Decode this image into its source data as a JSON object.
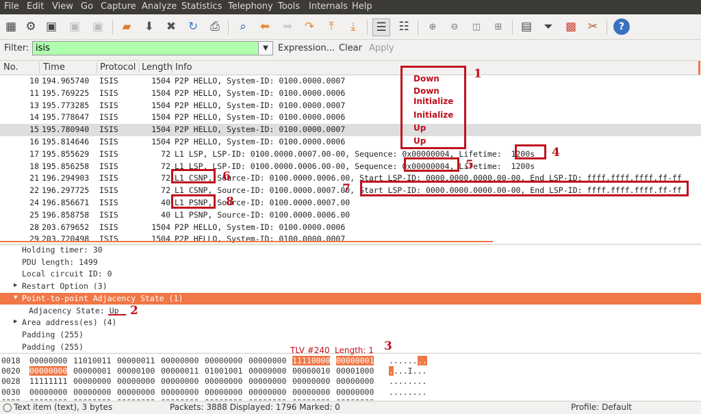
{
  "menu": [
    "File",
    "Edit",
    "View",
    "Go",
    "Capture",
    "Analyze",
    "Statistics",
    "Telephony",
    "Tools",
    "Internals",
    "Help"
  ],
  "toolbar": {
    "icons": [
      "interface-list-icon",
      "capture-options-icon",
      "start-capture-icon",
      "stop-capture-icon",
      "restart-capture-icon",
      "open-file-icon",
      "save-file-icon",
      "close-file-icon",
      "reload-icon",
      "print-icon",
      "find-packet-icon",
      "go-back-icon",
      "go-forward-icon",
      "go-to-packet-icon",
      "go-first-icon",
      "go-last-icon",
      "colorize-icon",
      "auto-scroll-icon",
      "zoom-in-icon",
      "zoom-out-icon",
      "normal-size-icon",
      "resize-columns-icon",
      "capture-filters-icon",
      "display-filters-icon",
      "coloring-rules-icon",
      "preferences-icon",
      "help-icon"
    ]
  },
  "filter": {
    "label": "Filter:",
    "value": "isis",
    "expression": "Expression...",
    "clear": "Clear",
    "apply": "Apply"
  },
  "packet_list": {
    "columns": [
      "No.",
      "Time",
      "Protocol",
      "Length",
      "Info"
    ],
    "rows": [
      {
        "no": "10",
        "time": "194.965740",
        "proto": "ISIS",
        "len": "1504",
        "info": "P2P HELLO, System-ID: 0100.0000.0007"
      },
      {
        "no": "11",
        "time": "195.769225",
        "proto": "ISIS",
        "len": "1504",
        "info": "P2P HELLO, System-ID: 0100.0000.0006"
      },
      {
        "no": "13",
        "time": "195.773285",
        "proto": "ISIS",
        "len": "1504",
        "info": "P2P HELLO, System-ID: 0100.0000.0007"
      },
      {
        "no": "14",
        "time": "195.778647",
        "proto": "ISIS",
        "len": "1504",
        "info": "P2P HELLO, System-ID: 0100.0000.0006"
      },
      {
        "no": "15",
        "time": "195.780940",
        "proto": "ISIS",
        "len": "1504",
        "info": "P2P HELLO, System-ID: 0100.0000.0007"
      },
      {
        "no": "16",
        "time": "195.814646",
        "proto": "ISIS",
        "len": "1504",
        "info": "P2P HELLO, System-ID: 0100.0000.0006"
      },
      {
        "no": "17",
        "time": "195.855629",
        "proto": "ISIS",
        "len": "72",
        "info": "L1 LSP, LSP-ID: 0100.0000.0007.00-00, Sequence: 0x00000004, Lifetime:  1200s"
      },
      {
        "no": "18",
        "time": "195.856258",
        "proto": "ISIS",
        "len": "72",
        "info": "L1 LSP, LSP-ID: 0100.0000.0006.00-00, Sequence: 0x00000004, Lifetime:  1200s"
      },
      {
        "no": "21",
        "time": "196.294903",
        "proto": "ISIS",
        "len": "72",
        "info": "L1 CSNP, Source-ID: 0100.0000.0006.00, Start LSP-ID: 0000.0000.0000.00-00, End LSP-ID: ffff.ffff.ffff.ff-ff"
      },
      {
        "no": "22",
        "time": "196.297725",
        "proto": "ISIS",
        "len": "72",
        "info": "L1 CSNP, Source-ID: 0100.0000.0007.00, Start LSP-ID: 0000.0000.0000.00-00, End LSP-ID: ffff.ffff.ffff.ff-ff"
      },
      {
        "no": "24",
        "time": "196.856671",
        "proto": "ISIS",
        "len": "40",
        "info": "L1 PSNP, Source-ID: 0100.0000.0007.00"
      },
      {
        "no": "25",
        "time": "196.858758",
        "proto": "ISIS",
        "len": "40",
        "info": "L1 PSNP, Source-ID: 0100.0000.0006.00"
      },
      {
        "no": "28",
        "time": "203.679652",
        "proto": "ISIS",
        "len": "1504",
        "info": "P2P HELLO, System-ID: 0100.0000.0006"
      },
      {
        "no": "29",
        "time": "203.720498",
        "proto": "ISIS",
        "len": "1504",
        "info": "P2P HELLO, System-ID: 0100.0000.0007"
      }
    ]
  },
  "details": {
    "rows": [
      {
        "text": "Holding timer: 30",
        "arrow": "",
        "hl": false
      },
      {
        "text": "PDU length: 1499",
        "arrow": "",
        "hl": false
      },
      {
        "text": "Local circuit ID: 0",
        "arrow": "",
        "hl": false
      },
      {
        "text": "Restart Option (3)",
        "arrow": "right",
        "hl": false
      },
      {
        "text": "Point-to-point Adjacency State (1)",
        "arrow": "down",
        "hl": true
      },
      {
        "text": "Adjacency State: Up",
        "arrow": "",
        "hl": false
      },
      {
        "text": "Area address(es) (4)",
        "arrow": "right",
        "hl": false
      },
      {
        "text": "Padding (255)",
        "arrow": "",
        "hl": false
      },
      {
        "text": "Padding (255)",
        "arrow": "",
        "hl": false
      }
    ]
  },
  "hex": {
    "rows": [
      {
        "offset": "0018",
        "bytes": [
          "00000000",
          "11010011",
          "00000011",
          "00000000",
          "00000000",
          "00000000",
          "11110000",
          "00000001"
        ],
        "ascii": "......",
        "ascii_hl": ".."
      },
      {
        "offset": "0020",
        "bytes": [
          "00000000",
          "00000001",
          "00000100",
          "00000011",
          "01001001",
          "00000000",
          "00000010",
          "00001000"
        ],
        "ascii_hl": ".",
        "ascii": "...I..."
      },
      {
        "offset": "0028",
        "bytes": [
          "11111111",
          "00000000",
          "00000000",
          "00000000",
          "00000000",
          "00000000",
          "00000000",
          "00000000"
        ],
        "ascii": "........"
      },
      {
        "offset": "0030",
        "bytes": [
          "00000000",
          "00000000",
          "00000000",
          "00000000",
          "00000000",
          "00000000",
          "00000000",
          "00000000"
        ],
        "ascii": "........"
      },
      {
        "offset": "0038",
        "bytes": [
          "00000000",
          "00000000",
          "00000000",
          "00000000",
          "00000000",
          "00000000",
          "00000000",
          "00000000"
        ],
        "ascii": "........"
      }
    ]
  },
  "status": {
    "item": "Text item (text), 3 bytes",
    "packets": "Packets: 3888 Displayed: 1796 Marked: 0",
    "profile": "Profile: Default"
  },
  "annotations": {
    "states": [
      "Down",
      "Down",
      "Initialize",
      "Initialize",
      "Up",
      "Up"
    ],
    "tlv": "TLV #240",
    "length": "Length: 1",
    "numbers": [
      "1",
      "2",
      "3",
      "4",
      "5",
      "6",
      "7",
      "8"
    ]
  },
  "colors": {
    "highlight": "#f07746",
    "filter_ok": "#afffaf",
    "annotation": "#c0101c"
  }
}
